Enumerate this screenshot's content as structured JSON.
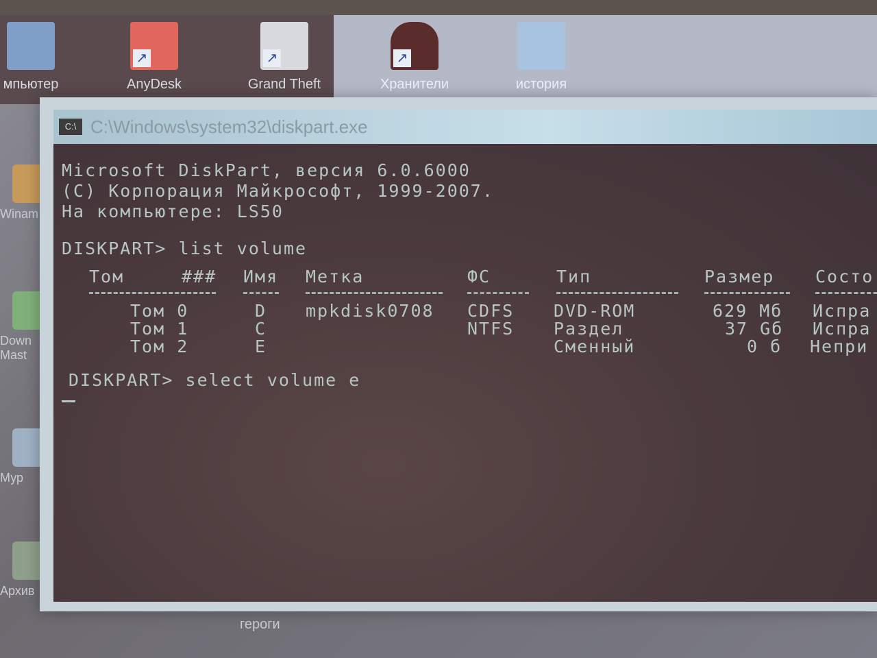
{
  "desktop": {
    "top_icons": [
      {
        "label": "мпьютер",
        "color": "#7f9fc8"
      },
      {
        "label": "AnyDesk",
        "color": "#e0675c"
      },
      {
        "label": "Grand Theft",
        "color": "#d8d8df"
      },
      {
        "label": "Хранители",
        "color": "#5a2c2c"
      },
      {
        "label": "история",
        "color": "#a7c3df"
      }
    ],
    "left_icons": [
      {
        "label": "Winam"
      },
      {
        "label": "Down Mast"
      },
      {
        "label": "Мур"
      },
      {
        "label": "Архив"
      }
    ],
    "bottom_label": "героги"
  },
  "window": {
    "title": "C:\\Windows\\system32\\diskpart.exe",
    "icon_label": "C:\\"
  },
  "console": {
    "header": [
      "Microsoft DiskPart, версия 6.0.6000",
      "(C) Корпорация Майкрософт, 1999-2007.",
      "На компьютере: LS50"
    ],
    "command1": "DISKPART> list volume",
    "columns": [
      "Том",
      "###",
      "Имя",
      "Метка",
      "ФС",
      "Тип",
      "Размер",
      "Состо"
    ],
    "rows": [
      {
        "vol": "Том 0",
        "letter": "D",
        "label": "mpkdisk0708",
        "fs": "CDFS",
        "type": "DVD-ROM",
        "size": "629 Мб",
        "status": "Испра"
      },
      {
        "vol": "Том 1",
        "letter": "C",
        "label": "",
        "fs": "NTFS",
        "type": "Раздел",
        "size": "37 Gб",
        "status": "Испра"
      },
      {
        "vol": "Том 2",
        "letter": "E",
        "label": "",
        "fs": "",
        "type": "Сменный",
        "size": "0 б",
        "status": "Непри"
      }
    ],
    "command2": "DISKPART> select volume e",
    "text_color": "#b7c6c2",
    "background_color": "#4b3a3d"
  }
}
